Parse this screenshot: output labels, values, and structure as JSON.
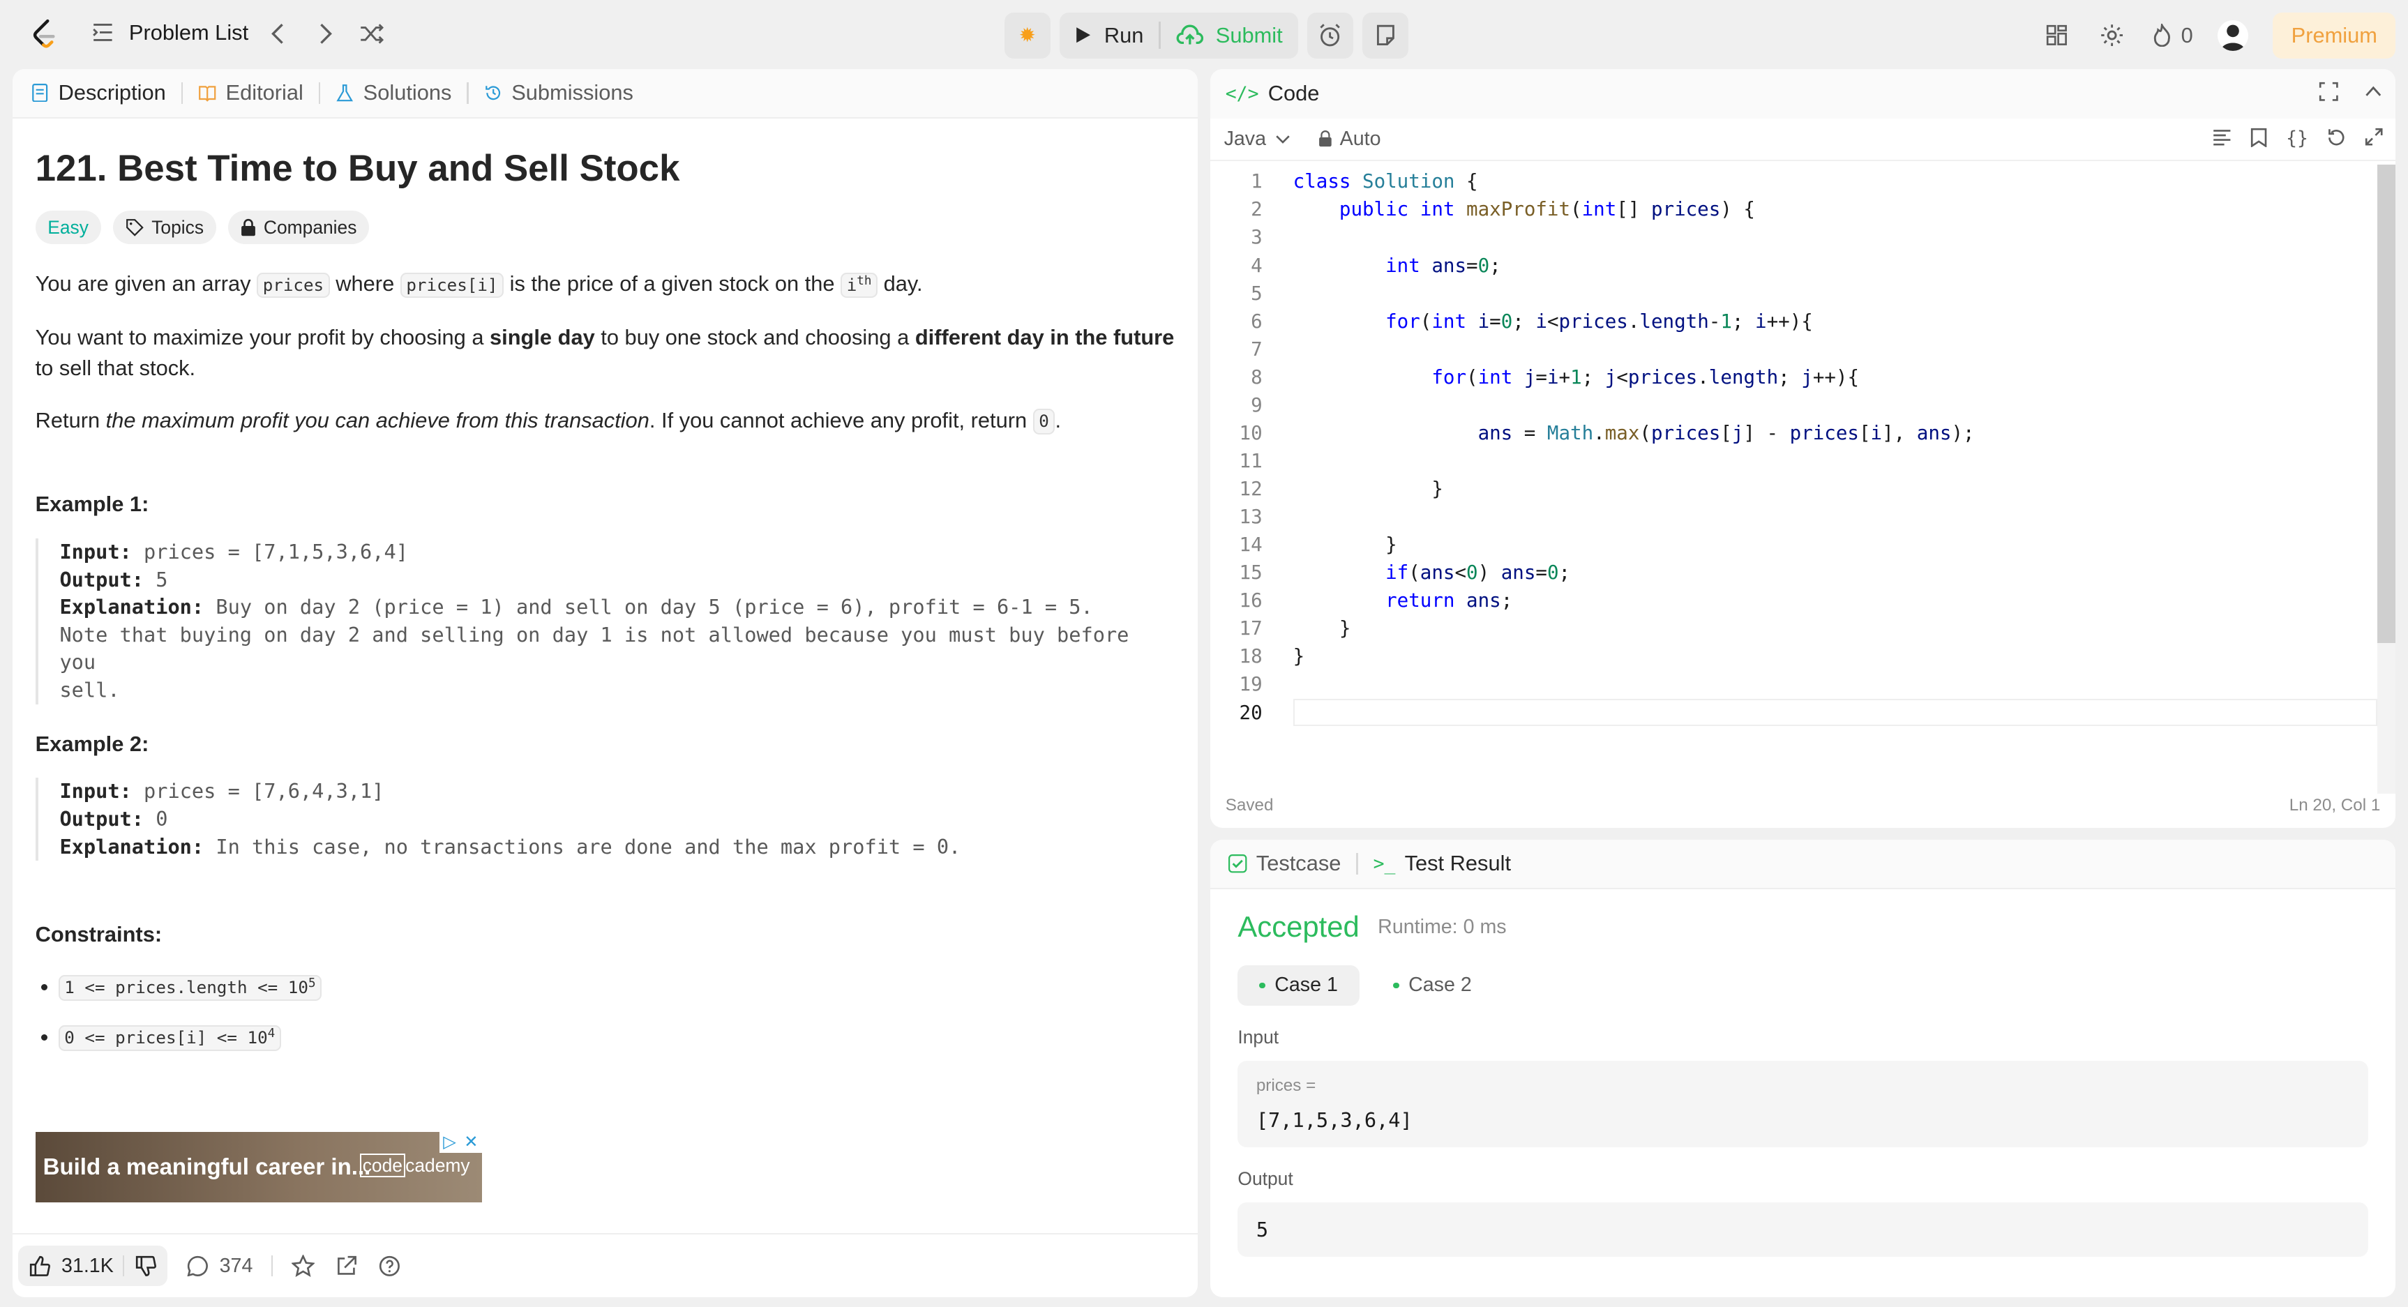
{
  "topbar": {
    "problem_list": "Problem List",
    "run": "Run",
    "submit": "Submit",
    "streak": "0",
    "premium": "Premium"
  },
  "left": {
    "tabs": [
      "Description",
      "Editorial",
      "Solutions",
      "Submissions"
    ],
    "title": "121. Best Time to Buy and Sell Stock",
    "badges": {
      "difficulty": "Easy",
      "topics": "Topics",
      "companies": "Companies"
    },
    "p1": {
      "a": "You are given an array ",
      "code1": "prices",
      "b": " where ",
      "code2": "prices[i]",
      "c": " is the price of a given stock on the ",
      "code3": "i",
      "sup": "th",
      "d": " day."
    },
    "p2": {
      "a": "You want to maximize your profit by choosing a ",
      "b1": "single day",
      "c": " to buy one stock and choosing a ",
      "b2": "different day in the future",
      "d": " to sell that stock."
    },
    "p3": {
      "a": "Return ",
      "i": "the maximum profit you can achieve from this transaction",
      "b": ". If you cannot achieve any profit, return ",
      "code": "0",
      "c": "."
    },
    "ex1": {
      "heading": "Example 1:",
      "input_label": "Input:",
      "input": " prices = [7,1,5,3,6,4]",
      "output_label": "Output:",
      "output": " 5",
      "expl_label": "Explanation:",
      "expl": " Buy on day 2 (price = 1) and sell on day 5 (price = 6), profit = 6-1 = 5.",
      "note": "Note that buying on day 2 and selling on day 1 is not allowed because you must buy before you",
      "note2": "sell."
    },
    "ex2": {
      "heading": "Example 2:",
      "input_label": "Input:",
      "input": " prices = [7,6,4,3,1]",
      "output_label": "Output:",
      "output": " 0",
      "expl_label": "Explanation:",
      "expl": " In this case, no transactions are done and the max profit = 0."
    },
    "constraints": {
      "heading": "Constraints:",
      "c1": "1 <= prices.length <= 10",
      "c1sup": "5",
      "c2": "0 <= prices[i] <= 10",
      "c2sup": "4"
    },
    "ad": {
      "text": "Build a meaningful career in...",
      "brand_a": "code",
      "brand_b": "cademy"
    },
    "footer": {
      "likes": "31.1K",
      "comments": "374"
    }
  },
  "code": {
    "title": "Code",
    "language": "Java",
    "mode": "Auto",
    "status": "Saved",
    "cursor": "Ln 20, Col 1",
    "line_numbers": [
      "1",
      "2",
      "3",
      "4",
      "5",
      "6",
      "7",
      "8",
      "9",
      "10",
      "11",
      "12",
      "13",
      "14",
      "15",
      "16",
      "17",
      "18",
      "19",
      "20"
    ]
  },
  "result": {
    "tabs": [
      "Testcase",
      "Test Result"
    ],
    "verdict": "Accepted",
    "runtime": "Runtime: 0 ms",
    "cases": [
      "Case 1",
      "Case 2"
    ],
    "input_label": "Input",
    "var_name": "prices =",
    "var_value": "[7,1,5,3,6,4]",
    "output_label": "Output",
    "output_value": "5"
  },
  "colors": {
    "accent_green": "#2cbb5d",
    "easy": "#00af9b",
    "premium": "#f0a13f"
  }
}
